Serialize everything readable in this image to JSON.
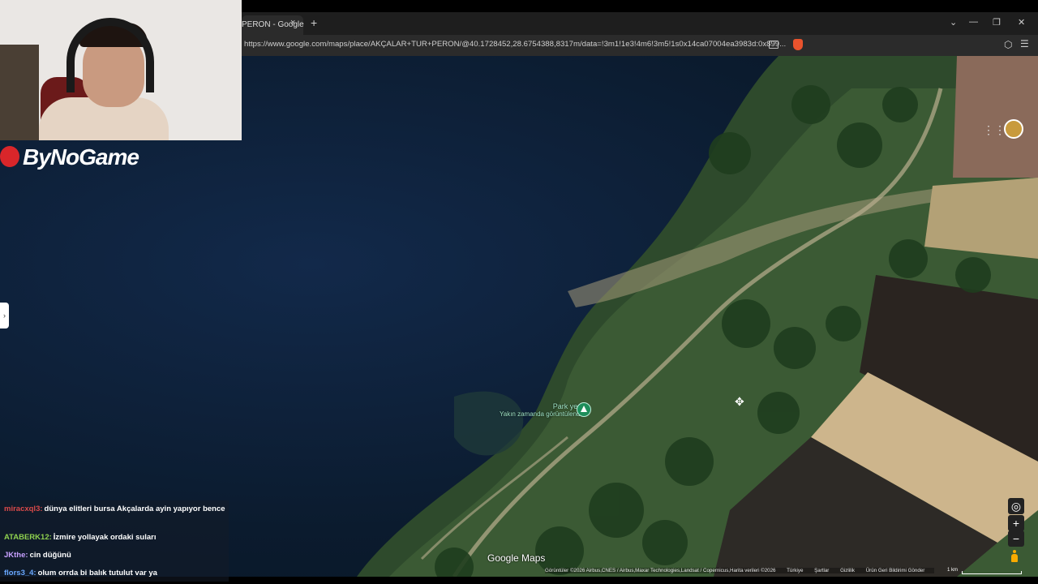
{
  "browser": {
    "tab_title": "PERON - Google",
    "tab_close": "×",
    "new_tab": "+",
    "url": "https://www.google.com/maps/place/AKÇALAR+TUR+PERON/@40.1728452,28.6754388,8317m/data=!3m1!1e3!4m6!3m5!1s0x14ca07004ea3983d:0x899...",
    "controls": {
      "tabs_menu": "⌄",
      "minimize": "—",
      "restore": "❐",
      "close": "✕"
    }
  },
  "streamer": {
    "brand": "ByNoGame"
  },
  "map": {
    "place_name": "Park yeri",
    "place_subtitle": "Yakın zamanda görüntülendi",
    "logo": "Google Maps",
    "attribution": {
      "imagery": "Görüntüler ©2026 Airbus,CNES / Airbus,Maxar Technologies,Landsat / Copernicus,Harita verileri ©2026",
      "region": "Türkiye",
      "terms": "Şartlar",
      "privacy": "Gizlilik",
      "feedback": "Ürün Geri Bildirimi Gönder"
    },
    "scale": "1 km",
    "controls": {
      "locate": "◎",
      "zoom_in": "+",
      "zoom_out": "−"
    }
  },
  "chat": [
    {
      "user": "miracxql3:",
      "message": "dünya elitleri bursa Akçalarda ayin yapıyor bence",
      "color": "#d94a4a"
    },
    {
      "user": "ATABERK12:",
      "message": "İzmire yollayak ordaki suları",
      "color": "#8fd14f"
    },
    {
      "user": "JKthe:",
      "message": "cin düğünü",
      "color": "#c7a0ff"
    },
    {
      "user": "flors3_4:",
      "message": "olum orrda bi balık tutulut var ya",
      "color": "#6aa8ff"
    }
  ]
}
